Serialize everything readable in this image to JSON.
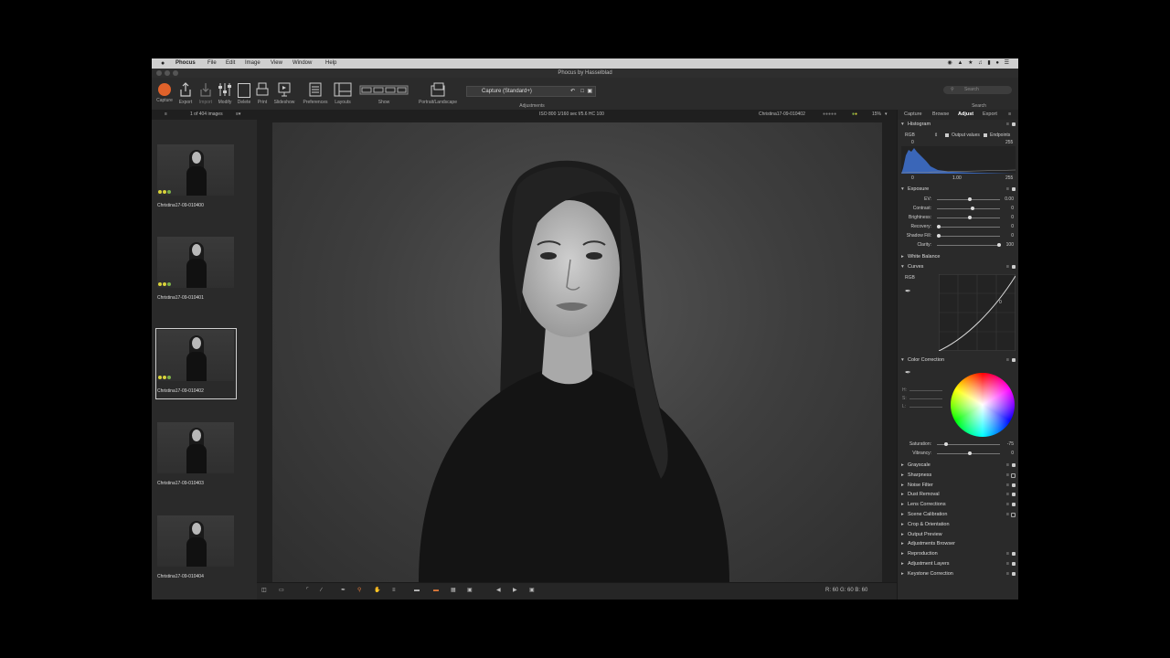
{
  "menubar": {
    "app": "Phocus",
    "items": [
      "File",
      "Edit",
      "Image",
      "View",
      "Window",
      "Help"
    ]
  },
  "window": {
    "title": "Phocus by Hasselblad"
  },
  "toolbar": {
    "buttons": [
      {
        "label": "Capture",
        "icon": "capture-record-icon"
      },
      {
        "label": "Export",
        "icon": "export-icon"
      },
      {
        "label": "Import",
        "icon": "import-icon"
      },
      {
        "label": "Modify",
        "icon": "modify-icon"
      },
      {
        "label": "Delete",
        "icon": "delete-icon"
      },
      {
        "label": "Print",
        "icon": "print-icon"
      },
      {
        "label": "Slideshow",
        "icon": "slideshow-icon"
      },
      {
        "label": "Preferences",
        "icon": "preferences-icon"
      },
      {
        "label": "Layouts",
        "icon": "layouts-icon"
      }
    ],
    "show_label": "Show",
    "portrait_label": "Portrait/Landscape",
    "preset_value": "Capture (Standard+)",
    "adjustments_label": "Adjustments",
    "search_placeholder": "Search",
    "search_label": "Search"
  },
  "info": {
    "count": "1 of 404 images",
    "exposure": "ISO 800  1/160 sec  f/5.6  HC 100",
    "filename": "Christina17-09-010402",
    "zoom": "15%"
  },
  "filmstrip": [
    {
      "name": "Christina17-09-010400",
      "selected": false
    },
    {
      "name": "Christina17-09-010401",
      "selected": false
    },
    {
      "name": "Christina17-09-010402",
      "selected": true
    },
    {
      "name": "Christina17-09-010403",
      "selected": false
    },
    {
      "name": "Christina17-09-010404",
      "selected": false
    }
  ],
  "panel": {
    "tabs": [
      "Capture",
      "Browse",
      "Adjust",
      "Export"
    ],
    "active_tab": "Adjust",
    "histogram": {
      "title": "Histogram",
      "channel": "RGB",
      "output_values_label": "Output values",
      "endpoints_label": "Endpoints",
      "low_out": "0",
      "high_out": "255",
      "low_in": "0",
      "gamma": "1.00",
      "high_in": "255"
    },
    "exposure": {
      "title": "Exposure",
      "rows": [
        {
          "label": "EV:",
          "value": "0.00",
          "pos": 0.5
        },
        {
          "label": "Contrast:",
          "value": "0",
          "pos": 0.55
        },
        {
          "label": "Brightness:",
          "value": "0",
          "pos": 0.5
        },
        {
          "label": "Recovery:",
          "value": "0",
          "pos": 0.0
        },
        {
          "label": "Shadow Fill:",
          "value": "0",
          "pos": 0.0
        },
        {
          "label": "Clarity:",
          "value": "100",
          "pos": 0.98
        }
      ]
    },
    "white_balance": "White Balance",
    "curves": {
      "title": "Curves",
      "channel": "RGB",
      "value": "0"
    },
    "color_correction": {
      "title": "Color Correction",
      "hsl_labels": [
        "H:",
        "S:",
        "L:"
      ],
      "rows": [
        {
          "label": "Saturation:",
          "value": "-75",
          "pos": 0.12
        },
        {
          "label": "Vibrancy:",
          "value": "0",
          "pos": 0.5
        }
      ]
    },
    "tools": [
      {
        "name": "Grayscale",
        "checked": true
      },
      {
        "name": "Sharpness",
        "checked": false
      },
      {
        "name": "Noise Filter",
        "checked": true
      },
      {
        "name": "Dust Removal",
        "checked": true
      },
      {
        "name": "Lens Corrections",
        "checked": true
      },
      {
        "name": "Scene Calibration",
        "checked": false
      },
      {
        "name": "Crop & Orientation",
        "checked": null
      },
      {
        "name": "Output Preview",
        "checked": null
      },
      {
        "name": "Adjustments Browser",
        "checked": null
      },
      {
        "name": "Reproduction",
        "checked": true
      },
      {
        "name": "Adjustment Layers",
        "checked": true
      },
      {
        "name": "Keystone Correction",
        "checked": true
      }
    ]
  },
  "readout": "R: 60  G: 60  B: 60",
  "colors": {
    "capture_orange": "#e0622a",
    "rating_yellow": "#d8d23a",
    "rating_green": "#7bb04a"
  }
}
